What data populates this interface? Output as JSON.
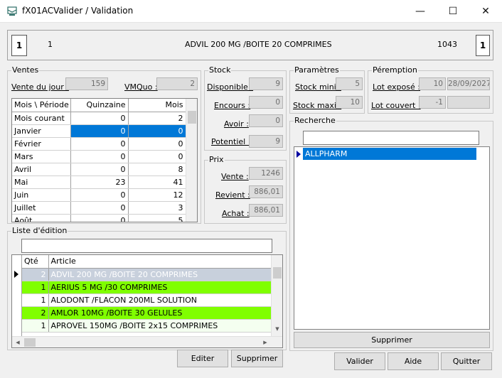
{
  "window": {
    "title": "fX01ACValider / Validation",
    "minimize": "—",
    "maximize": "☐",
    "close": "✕"
  },
  "header": {
    "left_box": "1",
    "left_num": "1",
    "product": "ADVIL 200 MG /BOITE 20 COMPRIMES",
    "code": "1043",
    "right_box": "1"
  },
  "ventes": {
    "legend": "Ventes",
    "vente_du_jour_label": "Vente du jour :",
    "vente_du_jour": "159",
    "vmquo_label": "VMQuo :",
    "vmquo": "2",
    "table": {
      "headers": [
        "Mois \\ Période",
        "Quinzaine",
        "Mois"
      ],
      "rows": [
        {
          "label": "Mois courant",
          "q": "0",
          "m": "2"
        },
        {
          "label": "Janvier",
          "q": "0",
          "m": "0"
        },
        {
          "label": "Février",
          "q": "0",
          "m": "0"
        },
        {
          "label": "Mars",
          "q": "0",
          "m": "0"
        },
        {
          "label": "Avril",
          "q": "0",
          "m": "8"
        },
        {
          "label": "Mai",
          "q": "23",
          "m": "41"
        },
        {
          "label": "Juin",
          "q": "0",
          "m": "12"
        },
        {
          "label": "Juillet",
          "q": "0",
          "m": "3"
        },
        {
          "label": "Août",
          "q": "0",
          "m": "5"
        }
      ]
    }
  },
  "stock": {
    "legend": "Stock",
    "disponible_label": "Disponible :",
    "disponible": "9",
    "encours_label": "Encours :",
    "encours": "0",
    "avoir_label": "Avoir :",
    "avoir": "0",
    "potentiel_label": "Potentiel :",
    "potentiel": "9"
  },
  "prix": {
    "legend": "Prix",
    "vente_label": "Vente :",
    "vente": "1246",
    "revient_label": "Revient :",
    "revient": "886,01",
    "achat_label": "Achat :",
    "achat": "886,01"
  },
  "parametres": {
    "legend": "Paramètres",
    "mini_label": "Stock mini :",
    "mini": "5",
    "maxi_label": "Stock maxi :",
    "maxi": "10"
  },
  "peremption": {
    "legend": "Péremption",
    "expose_label": "Lot exposé :",
    "expose_qty": "10",
    "expose_date": "28/09/2027",
    "couvert_label": "Lot couvert :",
    "couvert_qty": "-1",
    "couvert_date": ""
  },
  "recherche": {
    "legend": "Recherche",
    "search_value": "",
    "results": [
      "ALLPHARM"
    ],
    "supprimer": "Supprimer"
  },
  "liste": {
    "legend": "Liste d'édition",
    "filter_value": "",
    "headers": [
      "Qté",
      "Article"
    ],
    "rows": [
      {
        "qty": "2",
        "article": "ADVIL 200 MG /BOITE 20 COMPRIMES"
      },
      {
        "qty": "1",
        "article": "AERIUS 5 MG /30 COMPRIMES"
      },
      {
        "qty": "1",
        "article": "ALODONT /FLACON 200ML SOLUTION"
      },
      {
        "qty": "2",
        "article": "AMLOR 10MG /BOITE 30 GELULES"
      },
      {
        "qty": "1",
        "article": "APROVEL 150MG /BOITE 2x15 COMPRIMES"
      }
    ],
    "editer": "Editer",
    "supprimer": "Supprimer"
  },
  "footer": {
    "valider": "Valider",
    "aide": "Aide",
    "quitter": "Quitter"
  },
  "colors": {
    "selection": "#0078d7",
    "green_row": "#80ff00",
    "selected_row": "#c8d0dc"
  }
}
